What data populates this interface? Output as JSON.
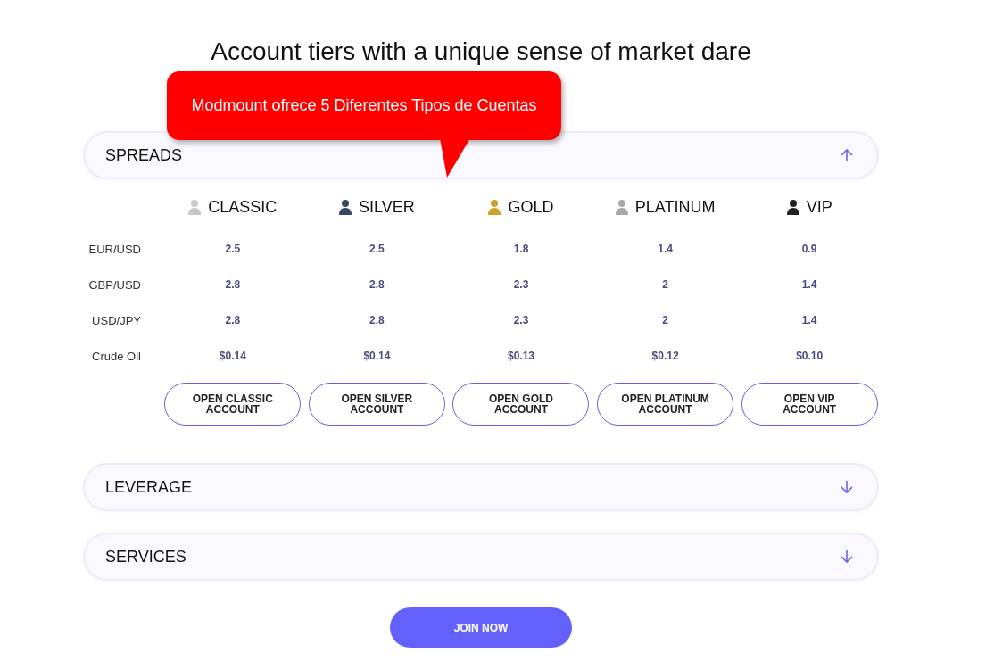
{
  "title": "Account tiers with a unique sense of market dare",
  "callout": {
    "text": "Modmount ofrece 5 Diferentes Tipos de Cuentas"
  },
  "sections": [
    {
      "label": "SPREADS",
      "expanded": true,
      "tiers": [
        {
          "name": "CLASSIC",
          "color": "#c8c8c8",
          "button": "OPEN CLASSIC ACCOUNT"
        },
        {
          "name": "SILVER",
          "color": "#34495e",
          "button": "OPEN SILVER ACCOUNT"
        },
        {
          "name": "GOLD",
          "color": "#c9a227",
          "button": "OPEN GOLD ACCOUNT"
        },
        {
          "name": "PLATINUM",
          "color": "#a9a9a9",
          "button": "OPEN PLATINUM ACCOUNT"
        },
        {
          "name": "VIP",
          "color": "#222222",
          "button": "OPEN VIP ACCOUNT"
        }
      ],
      "rows": [
        {
          "label": "EUR/USD",
          "values": [
            "2.5",
            "2.5",
            "1.8",
            "1.4",
            "0.9"
          ]
        },
        {
          "label": "GBP/USD",
          "values": [
            "2.8",
            "2.8",
            "2.3",
            "2",
            "1.4"
          ]
        },
        {
          "label": "USD/JPY",
          "values": [
            "2.8",
            "2.8",
            "2.3",
            "2",
            "1.4"
          ]
        },
        {
          "label": "Crude Oil",
          "values": [
            "$0.14",
            "$0.14",
            "$0.13",
            "$0.12",
            "$0.10"
          ]
        }
      ]
    },
    {
      "label": "LEVERAGE",
      "expanded": false
    },
    {
      "label": "SERVICES",
      "expanded": false
    }
  ],
  "join_button": "JOIN NOW"
}
